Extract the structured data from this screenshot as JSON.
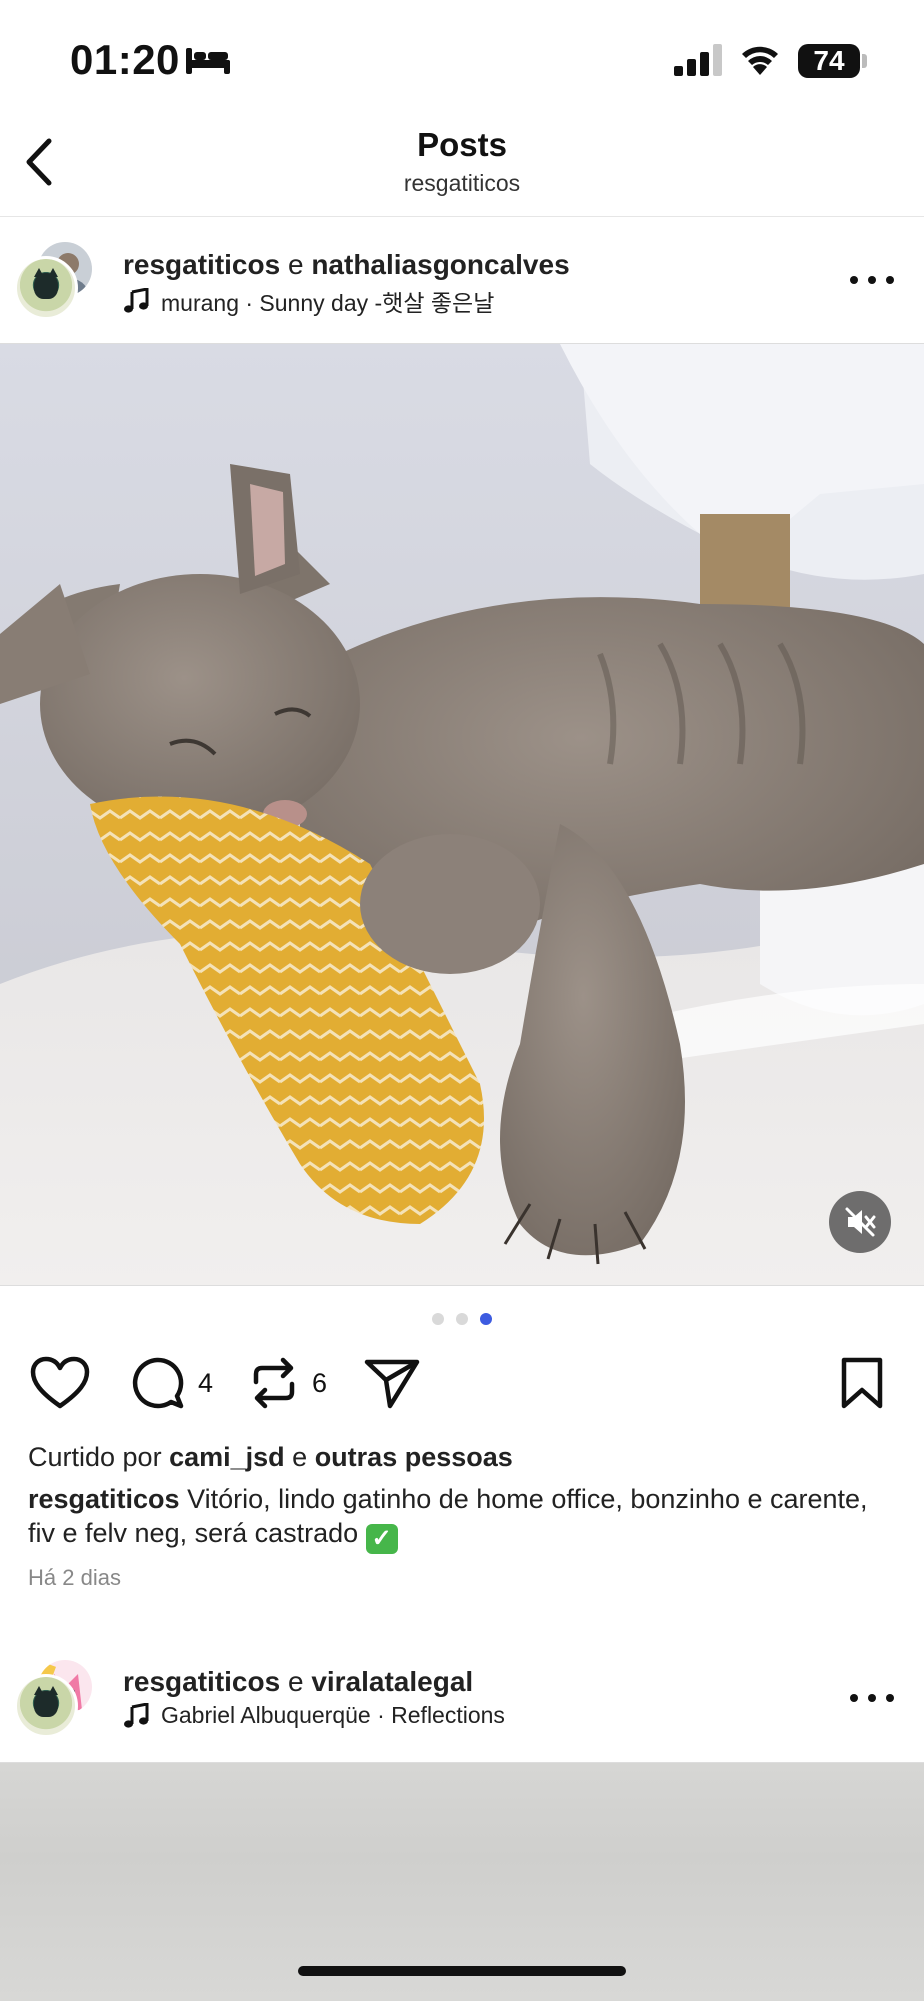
{
  "status_bar": {
    "time": "01:20",
    "battery": "74",
    "icons": [
      "bed-icon",
      "cellular-signal-icon",
      "wifi-icon",
      "battery-icon"
    ]
  },
  "header": {
    "title": "Posts",
    "subtitle": "resgatiticos"
  },
  "posts": [
    {
      "user_primary": "resgatiticos",
      "connector": " e ",
      "user_secondary": "nathaliasgoncalves",
      "music": "murang · Sunny day -햇살 좋은날",
      "media_page_count": 3,
      "media_active_page": 3,
      "comments_count": "4",
      "reposts_count": "6",
      "liked_by_prefix": "Curtido por ",
      "liked_by_user": "cami_jsd",
      "liked_by_connector": " e ",
      "liked_by_others": "outras pessoas",
      "caption_user": "resgatiticos",
      "caption_text": " Vitório, lindo gatinho de home office, bonzinho e carente, fiv e felv neg, será castrado ",
      "caption_emoji": "✓",
      "timestamp": "Há 2 dias"
    },
    {
      "user_primary": "resgatiticos",
      "connector": " e ",
      "user_secondary": "viralatalegal",
      "music": "Gabriel Albuquerqüe · Reflections"
    }
  ],
  "colors": {
    "active_dot": "#3d5be0",
    "inactive_dot": "#d9d9d9",
    "checkmark_green": "#46b64a"
  }
}
